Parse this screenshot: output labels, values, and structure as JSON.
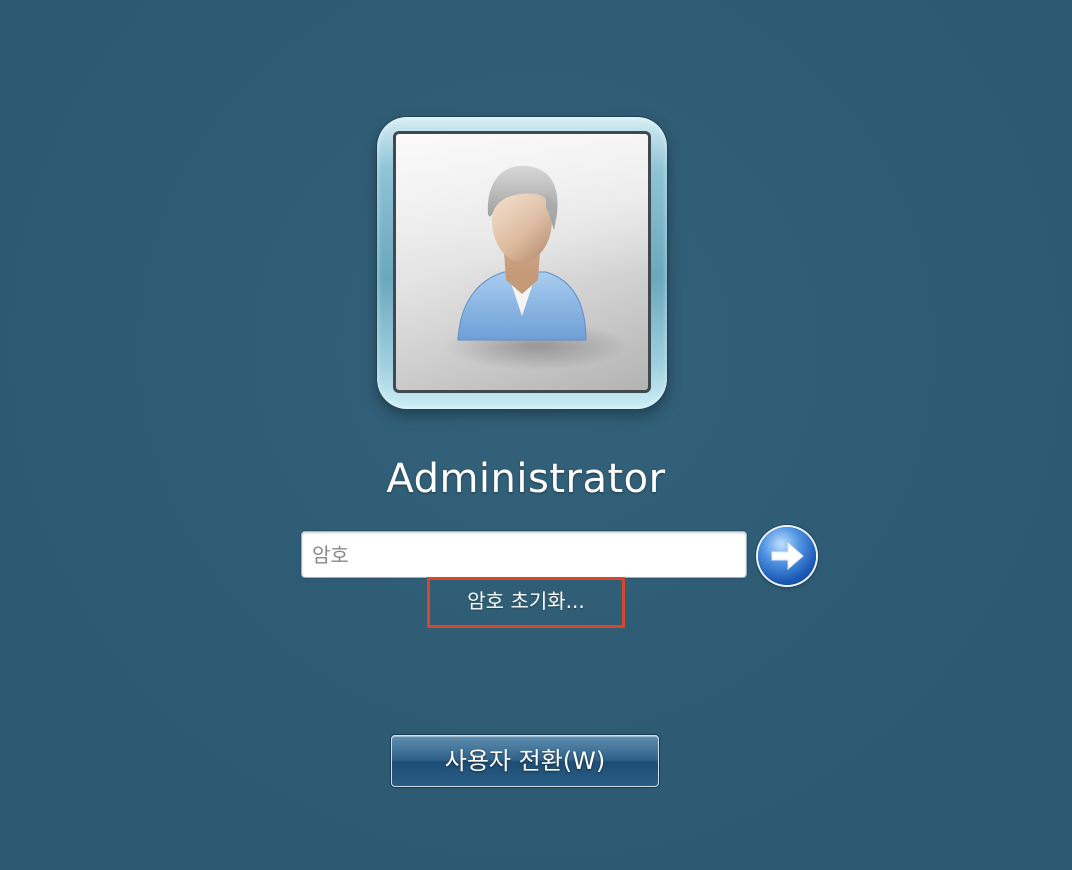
{
  "login": {
    "username": "Administrator",
    "password_placeholder": "암호",
    "password_value": "",
    "reset_password_link": "암호 초기화...",
    "submit_icon": "arrow-right-icon",
    "avatar_icon": "user-avatar-icon"
  },
  "footer": {
    "switch_user_label": "사용자 전환(W)"
  },
  "colors": {
    "background": "#2e5b73",
    "highlight_box": "#d9472b",
    "submit_button": "#1b58b5"
  }
}
